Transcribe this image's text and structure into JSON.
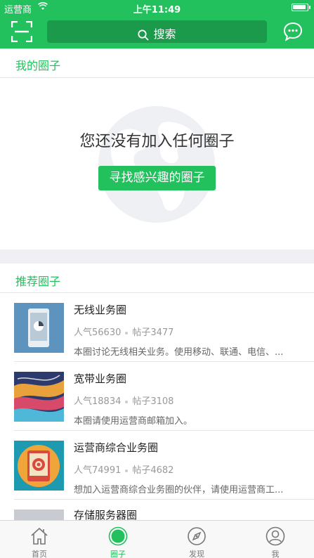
{
  "status_bar": {
    "carrier": "运营商",
    "time": "上午11:49"
  },
  "header": {
    "search_label": "搜索",
    "left_icon": "scan-icon",
    "right_icon": "chat-bubble-icon"
  },
  "my_circles": {
    "title": "我的圈子",
    "empty_text": "您还没有加入任何圈子",
    "find_button": "寻找感兴趣的圈子"
  },
  "recommended": {
    "title": "推荐圈子",
    "items": [
      {
        "name": "无线业务圈",
        "popularity": "人气56630",
        "posts": "帖子3477",
        "desc": "本圈讨论无线相关业务。使用移动、联通、电信、..."
      },
      {
        "name": "宽带业务圈",
        "popularity": "人气18834",
        "posts": "帖子3108",
        "desc": "本圈请使用运营商邮箱加入。"
      },
      {
        "name": "运营商综合业务圈",
        "popularity": "人气74991",
        "posts": "帖子4682",
        "desc": "想加入运营商综合业务圈的伙伴，请使用运营商工..."
      },
      {
        "name": "存储服务器圈",
        "popularity": "",
        "posts": "",
        "desc": ""
      }
    ]
  },
  "tabbar": {
    "tabs": [
      {
        "label": "首页",
        "icon": "home-icon"
      },
      {
        "label": "圈子",
        "icon": "circle-icon"
      },
      {
        "label": "发现",
        "icon": "compass-icon"
      },
      {
        "label": "我",
        "icon": "user-icon"
      }
    ],
    "active_index": 1
  },
  "colors": {
    "accent": "#22c15e",
    "search_bg": "#1a9a4a"
  }
}
